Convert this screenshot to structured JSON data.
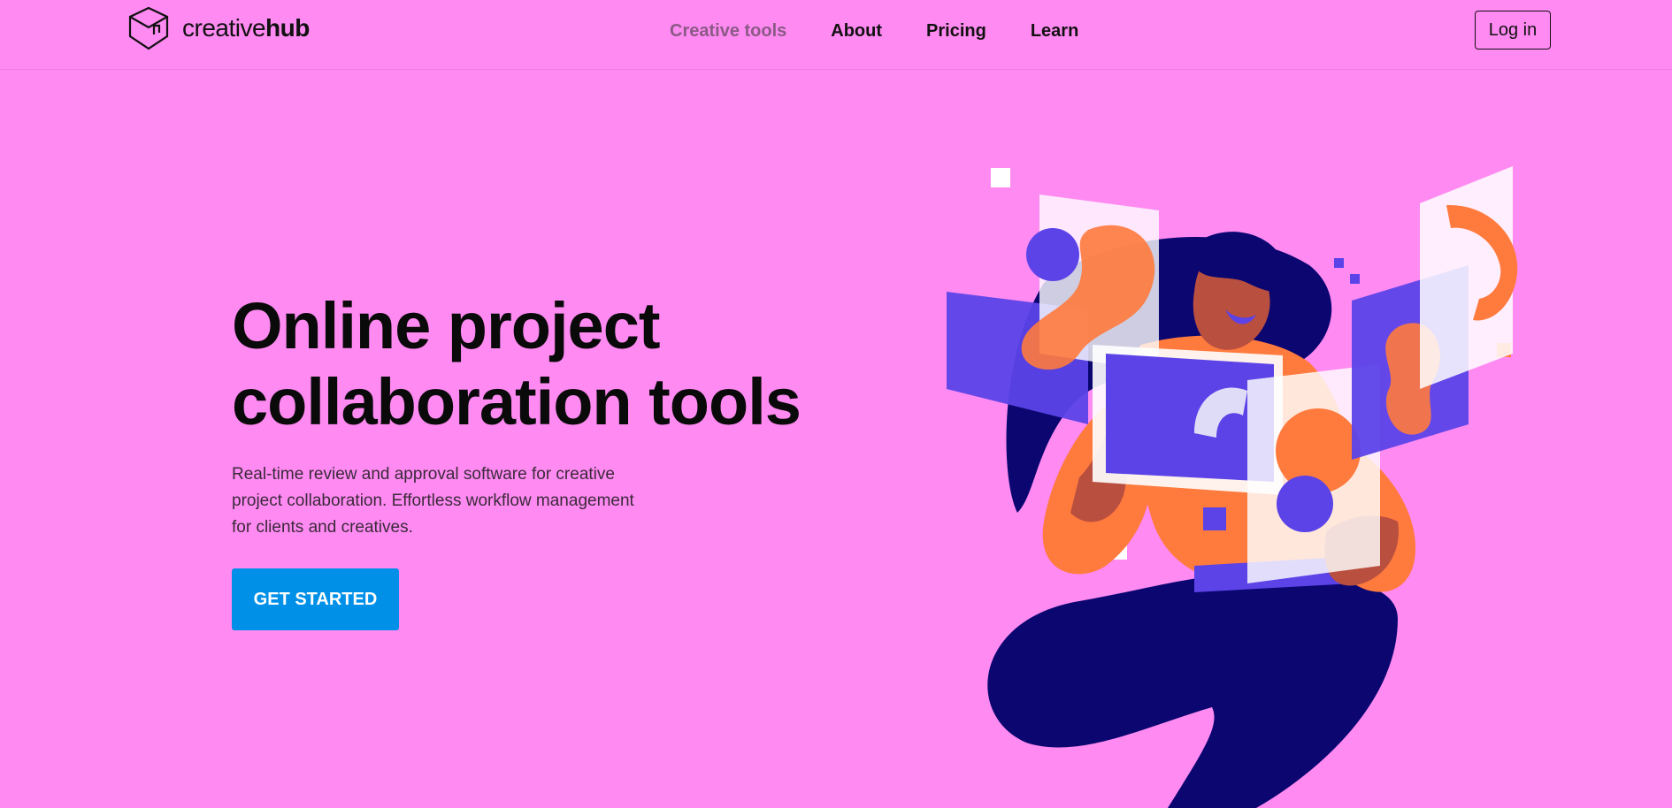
{
  "header": {
    "logo": {
      "light": "creative",
      "bold": "hub",
      "icon": "logo-icon"
    },
    "nav": [
      {
        "label": "Creative tools",
        "state": "muted"
      },
      {
        "label": "About"
      },
      {
        "label": "Pricing"
      },
      {
        "label": "Learn"
      }
    ],
    "login_label": "Log in"
  },
  "hero": {
    "title_line1": "Online project",
    "title_line2": "collaboration tools",
    "subtitle_line1": "Real-time review and approval software for creative",
    "subtitle_line2": "project collaboration. Effortless workflow management",
    "subtitle_line3": "for clients and creatives.",
    "cta_label": "GET STARTED"
  },
  "colors": {
    "background": "#ff8af2",
    "cta": "#0090e8",
    "navy": "#0b0670",
    "orange": "#ff7a3d",
    "violet": "#5b43e8"
  }
}
